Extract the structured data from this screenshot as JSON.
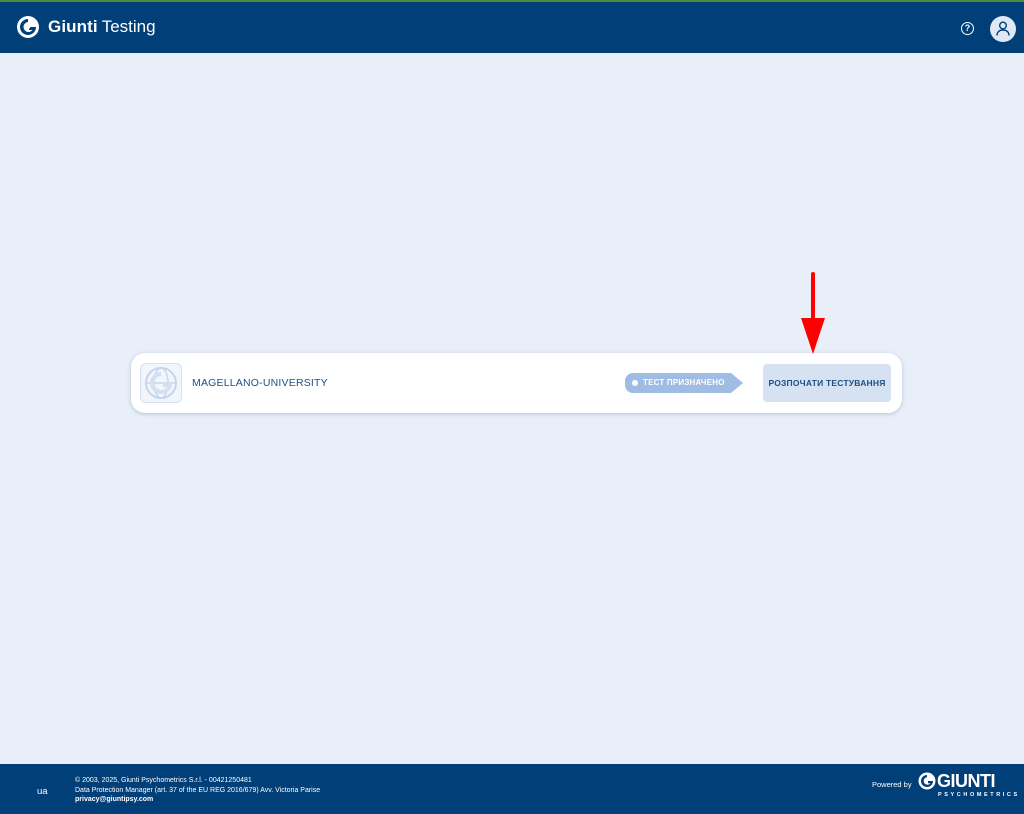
{
  "header": {
    "brand_name": "Giunti",
    "brand_suffix": "Testing",
    "help_symbol": "?",
    "icons": [
      "giunti-logo-icon",
      "help-icon",
      "user-icon"
    ]
  },
  "card": {
    "org_name": "MAGELLANO-UNIVERSITY",
    "status": "ТЕСТ ПРИЗНАЧЕНО",
    "start_label": "РОЗПОЧАТИ ТЕСТУВАННЯ"
  },
  "footer": {
    "lang": "ua",
    "copyright": "© 2003, 2025, Giunti Psychometrics S.r.l. - 00421250481",
    "dpm": "Data Protection Manager (art. 37 of the EU REG 2016/679) Avv. Victoria Parise",
    "email": "privacy@giuntipsy.com",
    "powered_by": "Powered by",
    "logo_word": "GIUNTI",
    "logo_sub": "PSYCHOMETRICS"
  },
  "colors": {
    "header_bg": "#003f78",
    "page_bg": "#e8eff9",
    "accent_text": "#1e4f86",
    "status_badge": "#9fbde2",
    "start_button_bg": "#d6e2f1",
    "annotation_arrow": "#ff0000"
  }
}
